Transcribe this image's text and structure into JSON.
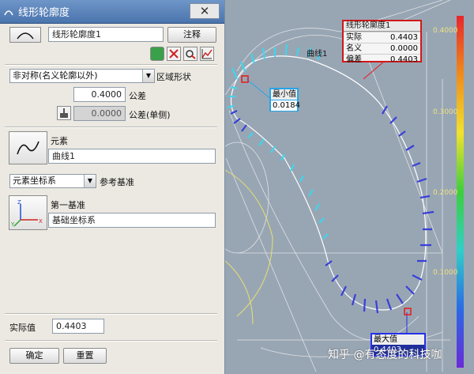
{
  "dialog": {
    "title": "线形轮廓度",
    "close": "✕",
    "feature_name": "线形轮廓度1",
    "annotate_button": "注释",
    "zone_type": "非对称(名义轮廓以外)",
    "zone_type_label": "区域形状",
    "tolerance_value": "0.4000",
    "tolerance_label": "公差",
    "tolerance_oneside_value": "0.0000",
    "tolerance_oneside_label": "公差(单侧)",
    "element_label": "元素",
    "element_value": "曲线1",
    "reference_type": "元素坐标系",
    "reference_label": "参考基准",
    "datum1_label": "第一基准",
    "datum1_value": "基础坐标系",
    "actual_label": "实际值",
    "actual_value": "0.4403",
    "ok_button": "确定",
    "reset_button": "重置"
  },
  "viewport": {
    "info_box": {
      "title": "线形轮廓度1",
      "rows": [
        {
          "label": "实际",
          "value": "0.4403"
        },
        {
          "label": "名义",
          "value": "0.0000"
        },
        {
          "label": "偏差",
          "value": "0.4403"
        }
      ]
    },
    "curve_label": "曲线1",
    "min_box": {
      "label": "最小值",
      "value": "0.0184"
    },
    "max_box": {
      "label": "最大值",
      "value": "0.4403"
    },
    "scale": {
      "labels": [
        "0.4000",
        "0.3000",
        "0.2000",
        "0.1000"
      ],
      "colors": [
        "#e8262a",
        "#f08c1a",
        "#f2e22a",
        "#3ccf3c",
        "#2fd0c8",
        "#2a6ae6",
        "#6a2ad8"
      ]
    },
    "watermark": "知乎 @有态度的科技咖"
  }
}
